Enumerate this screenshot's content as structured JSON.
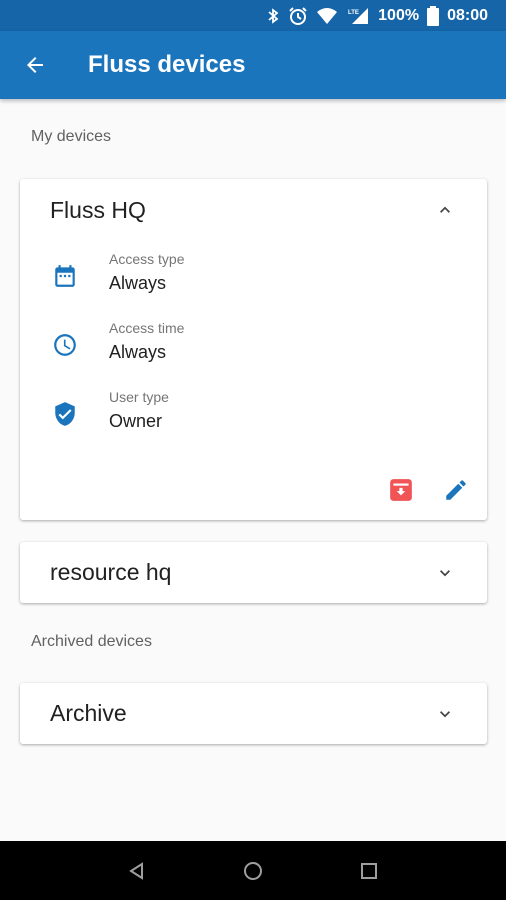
{
  "status_bar": {
    "battery": "100%",
    "time": "08:00",
    "network": "LTE"
  },
  "app_bar": {
    "title": "Fluss devices"
  },
  "my_devices": {
    "label": "My devices",
    "devices": [
      {
        "name": "Fluss HQ",
        "expanded": true,
        "details": [
          {
            "label": "Access type",
            "value": "Always",
            "icon": "calendar-icon"
          },
          {
            "label": "Access time",
            "value": "Always",
            "icon": "clock-icon"
          },
          {
            "label": "User type",
            "value": "Owner",
            "icon": "shield-check-icon"
          }
        ],
        "actions": [
          "archive-icon",
          "edit-icon"
        ]
      },
      {
        "name": "resource hq",
        "expanded": false
      }
    ]
  },
  "archived_devices": {
    "label": "Archived devices",
    "devices": [
      {
        "name": "Archive",
        "expanded": false
      }
    ]
  },
  "colors": {
    "primary": "#1b75bc",
    "status_bar": "#1565a8",
    "archive_red": "#f05454",
    "icon_blue": "#1b75bc"
  }
}
